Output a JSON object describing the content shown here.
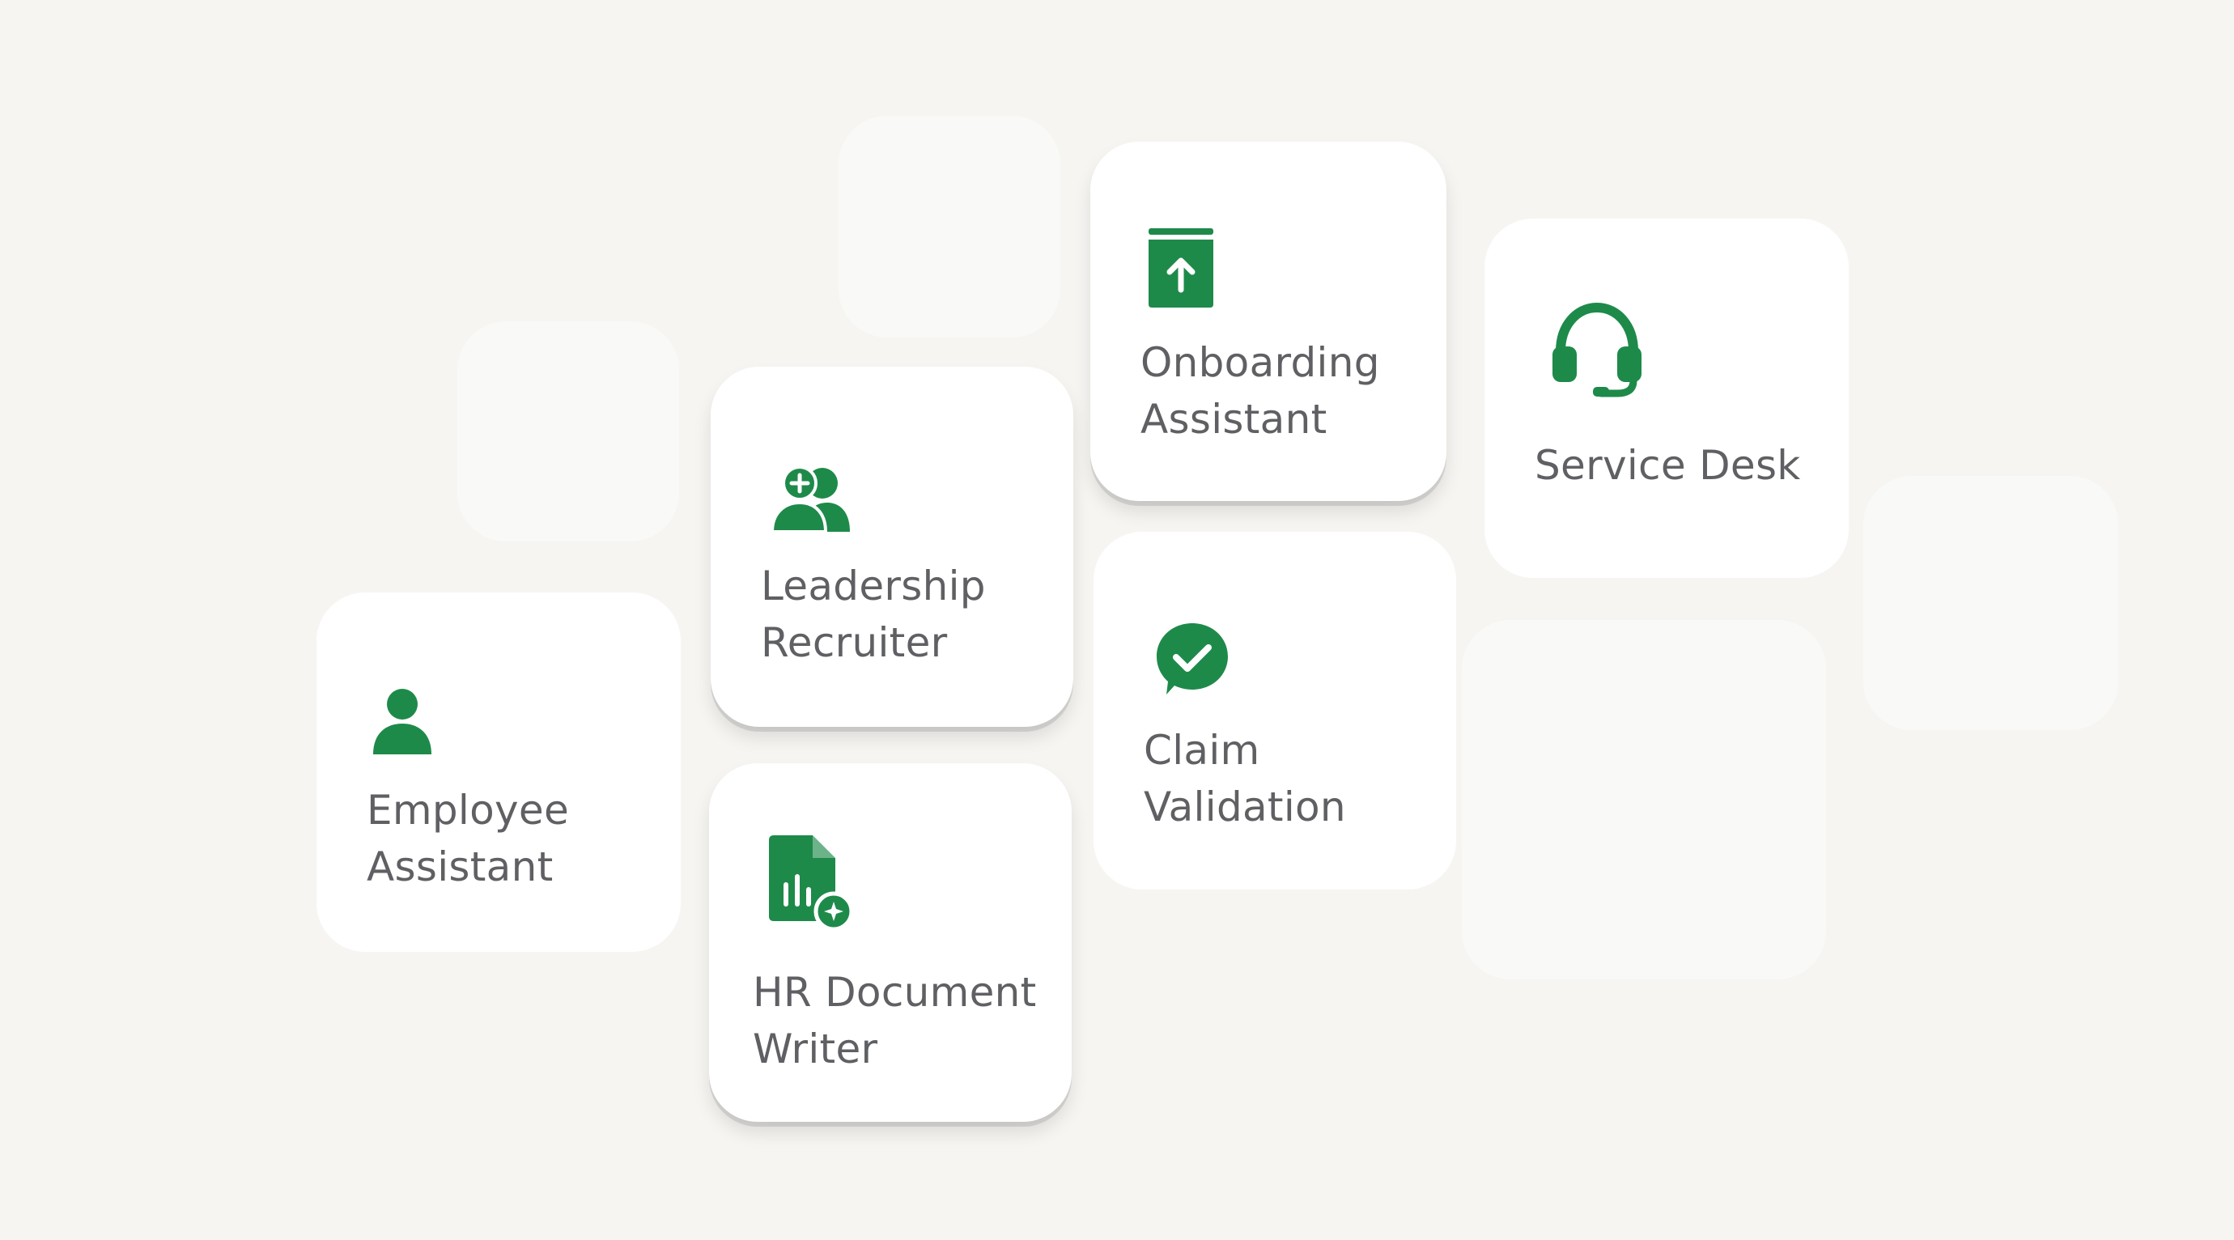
{
  "theme": {
    "background": "#f6f5f2",
    "card": "#ffffff",
    "accent": "#1e8a4a",
    "text": "#5f6063"
  },
  "cards": {
    "employee": {
      "label": "Employee\nAssistant",
      "icon": "person-icon"
    },
    "leadership": {
      "label": "Leadership\nRecruiter",
      "icon": "add-people-icon"
    },
    "hr_doc": {
      "label": "HR Document\nWriter",
      "icon": "document-chart-sparkle-icon"
    },
    "onboarding": {
      "label": "Onboarding\nAssistant",
      "icon": "book-upload-icon"
    },
    "claim": {
      "label": "Claim\nValidation",
      "icon": "check-chat-icon"
    },
    "service": {
      "label": "Service Desk",
      "icon": "headset-icon"
    }
  }
}
